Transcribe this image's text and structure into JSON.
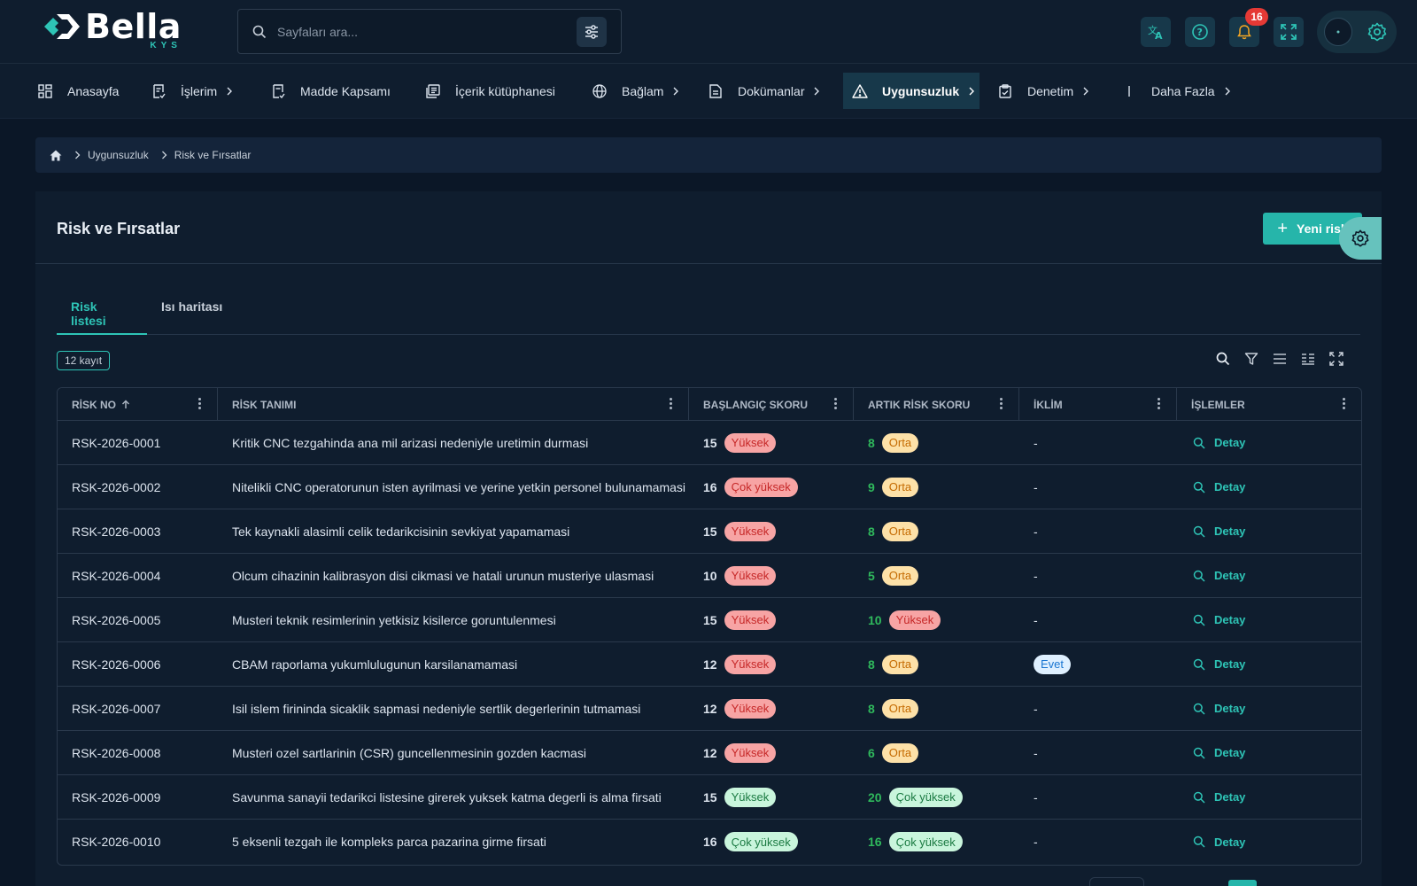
{
  "app": {
    "logo_word": "Bella",
    "logo_sub": "KYS"
  },
  "search": {
    "placeholder": "Sayfaları ara..."
  },
  "header": {
    "notification_count": "16"
  },
  "nav": {
    "items": [
      {
        "label": "Anasayfa"
      },
      {
        "label": "İşlerim"
      },
      {
        "label": "Madde Kapsamı"
      },
      {
        "label": "İçerik kütüphanesi"
      },
      {
        "label": "Bağlam"
      },
      {
        "label": "Dokümanlar"
      },
      {
        "label": "Uygunsuzluk"
      },
      {
        "label": "Denetim"
      },
      {
        "label": "Daha Fazla"
      }
    ]
  },
  "breadcrumb": {
    "items": [
      "Uygunsuzluk",
      "Risk ve Fırsatlar"
    ]
  },
  "page": {
    "title": "Risk ve Fırsatlar",
    "new_button": "Yeni risk",
    "tabs": [
      "Risk listesi",
      "Isı haritası"
    ],
    "record_count": "12 kayıt"
  },
  "table": {
    "columns": [
      "RİSK NO",
      "RİSK TANIMI",
      "BAŞLANGIÇ SKORU",
      "ARTIK RİSK SKORU",
      "İKLİM",
      "İŞLEMLER"
    ],
    "rows": [
      {
        "no": "RSK-2026-0001",
        "desc": "Kritik CNC tezgahinda ana mil arizasi nedeniyle uretimin durmasi",
        "start_score": "15",
        "start_label": "Yüksek",
        "start_color": "red",
        "res_score": "8",
        "res_label": "Orta",
        "res_color": "orange",
        "climate": "-",
        "action": "Detay"
      },
      {
        "no": "RSK-2026-0002",
        "desc": "Nitelikli CNC operatorunun isten ayrilmasi ve yerine yetkin personel bulunamamasi",
        "start_score": "16",
        "start_label": "Çok yüksek",
        "start_color": "red",
        "res_score": "9",
        "res_label": "Orta",
        "res_color": "orange",
        "climate": "-",
        "action": "Detay"
      },
      {
        "no": "RSK-2026-0003",
        "desc": "Tek kaynakli alasimli celik tedarikcisinin sevkiyat yapamamasi",
        "start_score": "15",
        "start_label": "Yüksek",
        "start_color": "red",
        "res_score": "8",
        "res_label": "Orta",
        "res_color": "orange",
        "climate": "-",
        "action": "Detay"
      },
      {
        "no": "RSK-2026-0004",
        "desc": "Olcum cihazinin kalibrasyon disi cikmasi ve hatali urunun musteriye ulasmasi",
        "start_score": "10",
        "start_label": "Yüksek",
        "start_color": "red",
        "res_score": "5",
        "res_label": "Orta",
        "res_color": "orange",
        "climate": "-",
        "action": "Detay"
      },
      {
        "no": "RSK-2026-0005",
        "desc": "Musteri teknik resimlerinin yetkisiz kisilerce goruntulenmesi",
        "start_score": "15",
        "start_label": "Yüksek",
        "start_color": "red",
        "res_score": "10",
        "res_label": "Yüksek",
        "res_color": "red",
        "climate": "-",
        "action": "Detay"
      },
      {
        "no": "RSK-2026-0006",
        "desc": "CBAM raporlama yukumlulugunun karsilanamamasi",
        "start_score": "12",
        "start_label": "Yüksek",
        "start_color": "red",
        "res_score": "8",
        "res_label": "Orta",
        "res_color": "orange",
        "climate": "Evet",
        "action": "Detay"
      },
      {
        "no": "RSK-2026-0007",
        "desc": "Isil islem firininda sicaklik sapmasi nedeniyle sertlik degerlerinin tutmamasi",
        "start_score": "12",
        "start_label": "Yüksek",
        "start_color": "red",
        "res_score": "8",
        "res_label": "Orta",
        "res_color": "orange",
        "climate": "-",
        "action": "Detay"
      },
      {
        "no": "RSK-2026-0008",
        "desc": "Musteri ozel sartlarinin (CSR) guncellenmesinin gozden kacmasi",
        "start_score": "12",
        "start_label": "Yüksek",
        "start_color": "red",
        "res_score": "6",
        "res_label": "Orta",
        "res_color": "orange",
        "climate": "-",
        "action": "Detay"
      },
      {
        "no": "RSK-2026-0009",
        "desc": "Savunma sanayii tedarikci listesine girerek yuksek katma degerli is alma firsati",
        "start_score": "15",
        "start_label": "Yüksek",
        "start_color": "green",
        "res_score": "20",
        "res_label": "Çok yüksek",
        "res_color": "green",
        "climate": "-",
        "action": "Detay"
      },
      {
        "no": "RSK-2026-0010",
        "desc": "5 eksenli tezgah ile kompleks parca pazarina girme firsati",
        "start_score": "16",
        "start_label": "Çok yüksek",
        "start_color": "green",
        "res_score": "16",
        "res_label": "Çok yüksek",
        "res_color": "green",
        "climate": "-",
        "action": "Detay"
      }
    ]
  },
  "colors": {
    "accent": "#2ec4b6",
    "background": "#0b1727",
    "panel": "#0f1d2e"
  }
}
